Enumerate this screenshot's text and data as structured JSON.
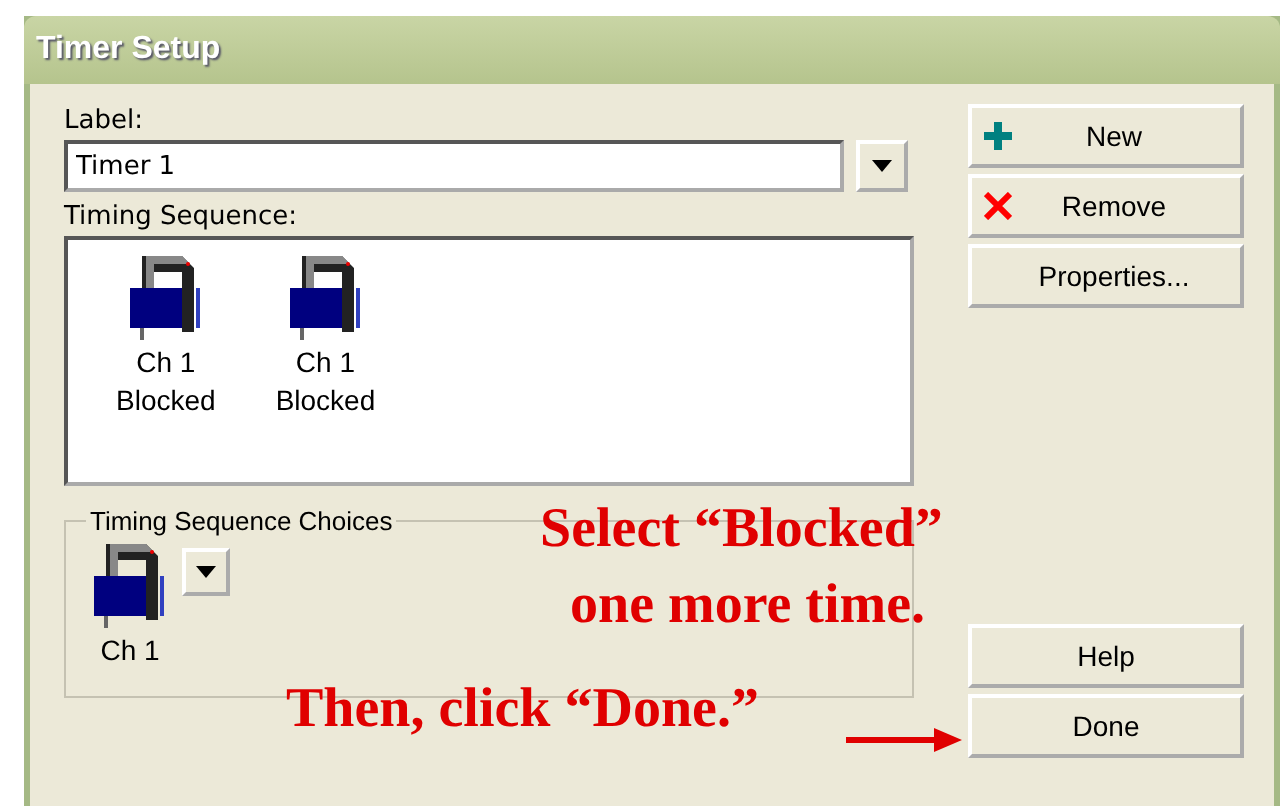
{
  "window": {
    "title": "Timer Setup"
  },
  "label_field": {
    "caption": "Label:",
    "value": "Timer 1"
  },
  "sequence": {
    "caption": "Timing Sequence:",
    "items": [
      {
        "kind": "blocked",
        "line1": "Ch 1",
        "line2": "Blocked"
      },
      {
        "kind": "blocked",
        "line1": "Ch 1",
        "line2": "Blocked"
      }
    ]
  },
  "choices": {
    "caption": "Timing Sequence Choices",
    "item": {
      "kind": "blocked",
      "line1": "Ch 1"
    }
  },
  "buttons": [
    {
      "kind": "new",
      "label": "New"
    },
    {
      "kind": "remove",
      "label": "Remove"
    },
    {
      "kind": "plain",
      "label": "Properties..."
    }
  ],
  "bottom_buttons": [
    {
      "label": "Help"
    },
    {
      "label": "Done"
    }
  ],
  "annotations": [
    {
      "text": "Select “Blocked”"
    },
    {
      "text": "one more time."
    },
    {
      "text": "Then, click “Done.”"
    }
  ]
}
